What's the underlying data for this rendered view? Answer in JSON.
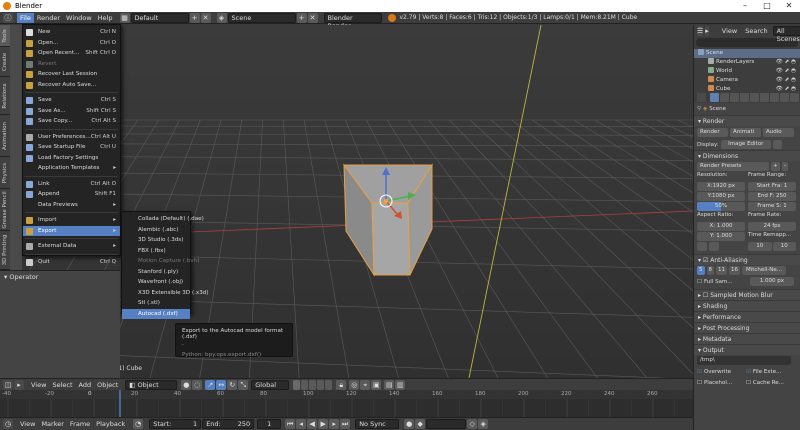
{
  "window": {
    "title": "Blender",
    "minimize": "–",
    "maximize": "□",
    "close": "✕"
  },
  "info_header": {
    "menus": [
      "File",
      "Render",
      "Window",
      "Help"
    ],
    "layout": "Default",
    "scene": "Scene",
    "engine": "Blender Render",
    "stats": "v2.79 | Verts:8 | Faces:6 | Tris:12 | Objects:1/3 | Lamps:0/1 | Mem:8.21M | Cube"
  },
  "left_tabs": [
    "Tools",
    "Create",
    "Relations",
    "Animation",
    "Physics",
    "Grease Pencil",
    "3D Printing"
  ],
  "operator_panel": {
    "title": "Operator"
  },
  "file_menu": {
    "items": [
      {
        "label": "New",
        "shortcut": "Ctrl N",
        "icon_color": "#dddddd"
      },
      {
        "label": "Open...",
        "shortcut": "Ctrl O",
        "icon_color": "#c8a040"
      },
      {
        "label": "Open Recent...",
        "shortcut": "Shift Ctrl O",
        "icon_color": "#c8a040"
      },
      {
        "label": "Revert",
        "shortcut": "",
        "icon_color": "#777777",
        "disabled": true
      },
      {
        "label": "Recover Last Session",
        "shortcut": "",
        "icon_color": "#c8a040"
      },
      {
        "label": "Recover Auto Save...",
        "shortcut": "",
        "icon_color": "#c8a040"
      },
      {
        "sep": true
      },
      {
        "label": "Save",
        "shortcut": "Ctrl S",
        "icon_color": "#88a8d8"
      },
      {
        "label": "Save As...",
        "shortcut": "Shift Ctrl S",
        "icon_color": "#88a8d8"
      },
      {
        "label": "Save Copy...",
        "shortcut": "Ctrl Alt S",
        "icon_color": "#88a8d8"
      },
      {
        "sep": true
      },
      {
        "label": "User Preferences...",
        "shortcut": "Ctrl Alt U",
        "icon_color": "#aaaaaa"
      },
      {
        "label": "Save Startup File",
        "shortcut": "Ctrl U",
        "icon_color": "#88a8d8"
      },
      {
        "label": "Load Factory Settings",
        "shortcut": "",
        "icon_color": "#88a8d8"
      },
      {
        "label": "Application Templates",
        "shortcut": "▸",
        "icon_color": ""
      },
      {
        "sep": true
      },
      {
        "label": "Link",
        "shortcut": "Ctrl Alt O",
        "icon_color": "#88a8d8"
      },
      {
        "label": "Append",
        "shortcut": "Shift F1",
        "icon_color": "#88a8d8"
      },
      {
        "label": "Data Previews",
        "shortcut": "▸",
        "icon_color": ""
      },
      {
        "sep": true
      },
      {
        "label": "Import",
        "shortcut": "▸",
        "icon_color": "#c8a040"
      },
      {
        "label": "Export",
        "shortcut": "▸",
        "icon_color": "#c8a040",
        "highlight": true
      },
      {
        "sep": true
      },
      {
        "label": "External Data",
        "shortcut": "▸",
        "icon_color": "#aaaaaa"
      },
      {
        "sep": true
      },
      {
        "label": "Quit",
        "shortcut": "Ctrl Q",
        "icon_color": "#cccccc"
      }
    ]
  },
  "export_menu": {
    "items": [
      {
        "label": "Collada (Default) (.dae)"
      },
      {
        "label": "Alembic (.abc)"
      },
      {
        "label": "3D Studio (.3ds)"
      },
      {
        "label": "FBX (.fbx)"
      },
      {
        "label": "Motion Capture (.bvh)",
        "disabled": true
      },
      {
        "label": "Stanford (.ply)"
      },
      {
        "label": "Wavefront (.obj)"
      },
      {
        "label": "X3D Extensible 3D (.x3d)"
      },
      {
        "label": "Stl (.stl)"
      },
      {
        "label": "Autocad (.dxf)",
        "highlight": true
      }
    ]
  },
  "tooltip": {
    "line1": "Export to the Autocad model format (.dxf)",
    "line2": ".",
    "python": "Python: bpy.ops.export.dxf()"
  },
  "viewport": {
    "object_label": "(1) Cube"
  },
  "view3d_header": {
    "menus": [
      "View",
      "Select",
      "Add",
      "Object"
    ],
    "mode": "Object Mode",
    "orientation": "Global"
  },
  "timeline": {
    "ticks": [
      "-40",
      "-20",
      "0",
      "20",
      "40",
      "60",
      "80",
      "100",
      "120",
      "140",
      "160",
      "180",
      "200",
      "220",
      "240",
      "260"
    ],
    "menus": [
      "View",
      "Marker",
      "Frame",
      "Playback"
    ],
    "start_label": "Start:",
    "start_value": "1",
    "end_label": "End:",
    "end_value": "250",
    "current_frame": "1",
    "sync": "No Sync"
  },
  "outliner": {
    "menus": [
      "View",
      "Search"
    ],
    "filter": "All Scenes",
    "rows": [
      {
        "label": "Scene",
        "color": "#8aa0c0",
        "indent": 0,
        "selected": true
      },
      {
        "label": "RenderLayers",
        "color": "#aaaaaa",
        "indent": 1
      },
      {
        "label": "World",
        "color": "#88aa88",
        "indent": 1
      },
      {
        "label": "Camera",
        "color": "#d08a4a",
        "indent": 1
      },
      {
        "label": "Cube",
        "color": "#d08a4a",
        "indent": 1
      }
    ]
  },
  "properties": {
    "context": "Scene",
    "render_section": "Render",
    "render_buttons": [
      "Render",
      "Animati",
      "Audio"
    ],
    "display_label": "Display:",
    "display_value": "Image Editor",
    "dimensions_section": "Dimensions",
    "render_presets": "Render Presets",
    "resolution_label": "Resolution:",
    "res_x": "X:1920 px",
    "res_y": "Y:1080 px",
    "res_pct": "50%",
    "frame_range_label": "Frame Range:",
    "start_frame": "Start Fra: 1",
    "end_frame": "End F: 250",
    "frame_step": "Frame S: 1",
    "aspect_label": "Aspect Ratio:",
    "aspect_x": "X:   1.000",
    "aspect_y": "Y:   1.000",
    "frame_rate_label": "Frame Rate:",
    "frame_rate": "24 fps",
    "time_remap_label": "Time Remapp...",
    "remap_old": "10",
    "remap_new": "10",
    "aa_section": "Anti-Aliasing",
    "aa_samples": [
      "5",
      "8",
      "11",
      "16"
    ],
    "aa_filter": "Mitchell-Ne...",
    "full_sample": "Full Sam...",
    "filter_size": "1.000 px",
    "collapsed_sections": [
      "Sampled Motion Blur",
      "Shading",
      "Performance",
      "Post Processing",
      "Metadata"
    ],
    "output_section": "Output",
    "output_path": "/tmp\\",
    "overwrite": "Overwrite",
    "file_extensions": "File Exte...",
    "placeholders": "Placehol...",
    "cache_result": "Cache Re..."
  }
}
